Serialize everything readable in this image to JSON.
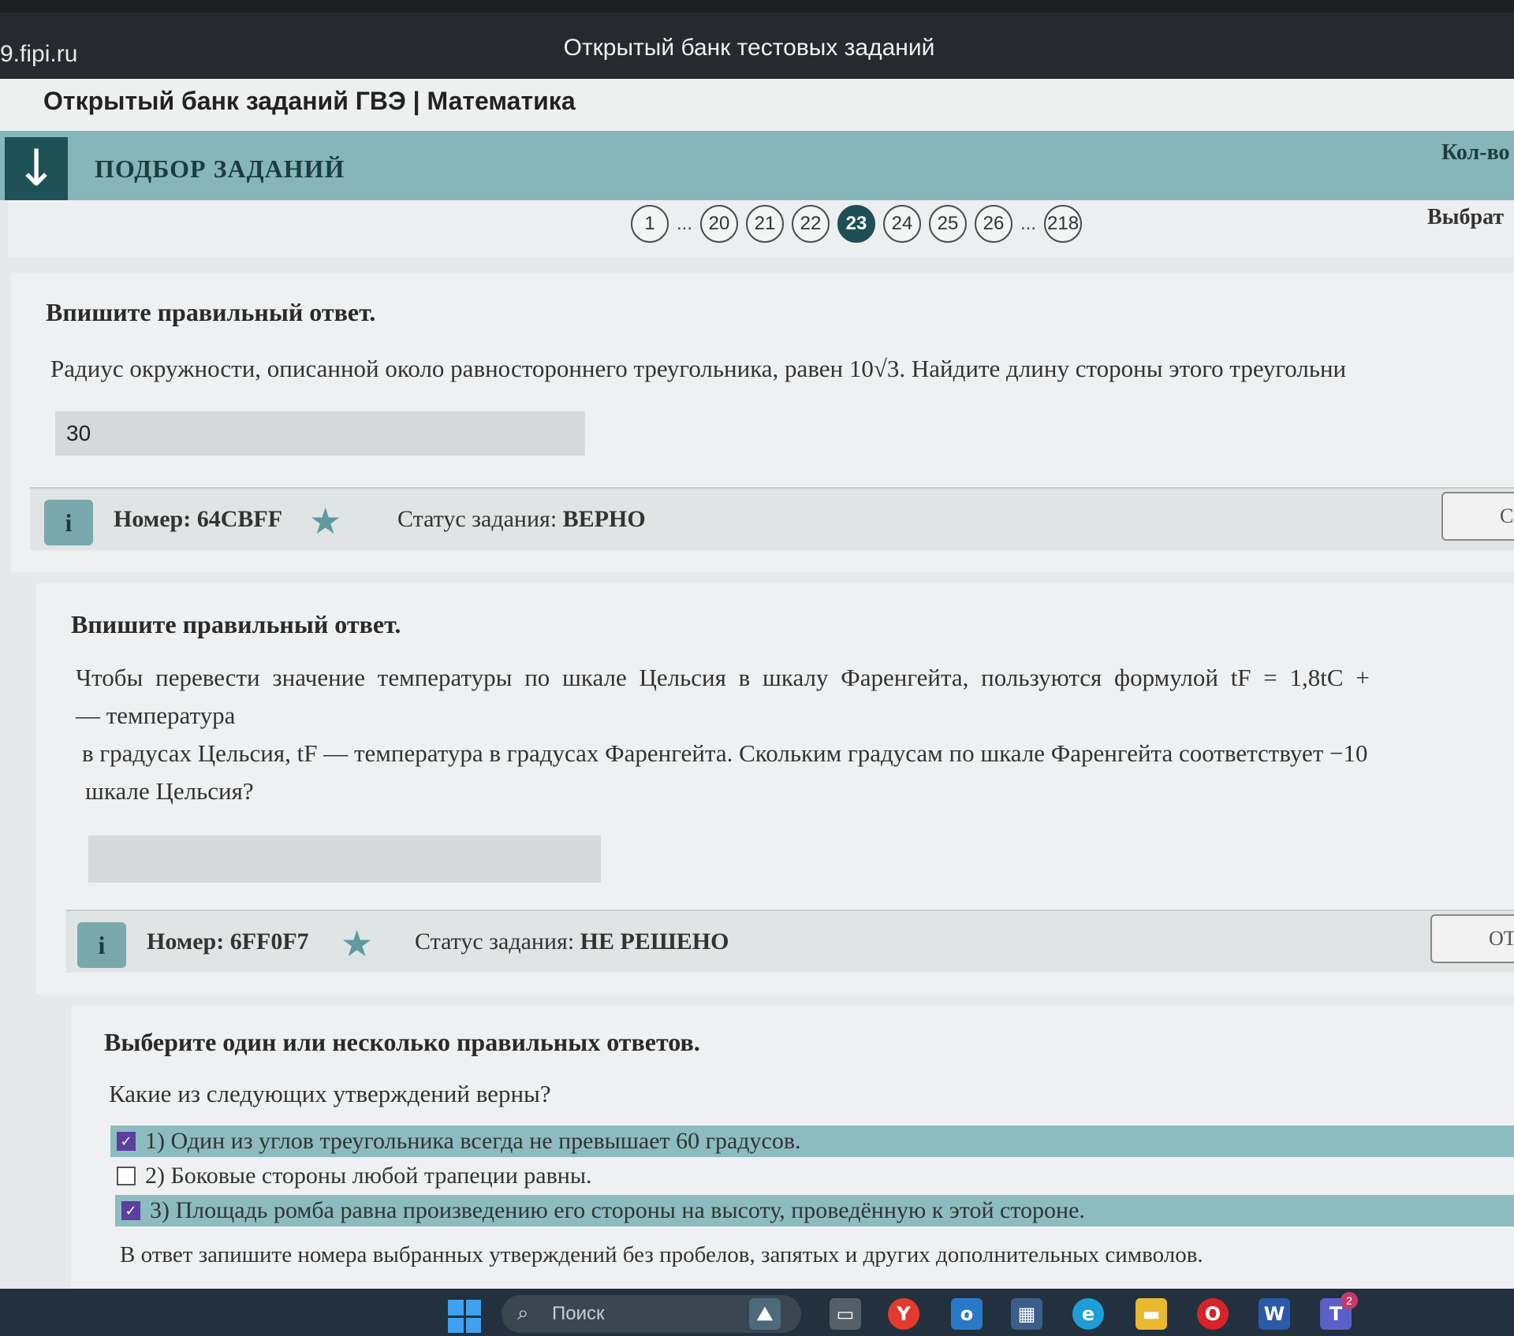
{
  "browser": {
    "domain": "9.fipi.ru",
    "window_title": "Открытый банк тестовых заданий"
  },
  "site": {
    "brand": "Открытый банк заданий ГВЭ | Математика"
  },
  "selection_bar": {
    "title": "ПОДБОР ЗАДАНИЙ",
    "count_label": "Кол-во",
    "select_label": "Выбрат"
  },
  "pagination": {
    "first": "1",
    "ellipsis": "...",
    "pages": [
      "20",
      "21",
      "22",
      "23",
      "24",
      "25",
      "26"
    ],
    "active": "23",
    "last": "218"
  },
  "tasks": [
    {
      "instruction": "Впишите правильный ответ.",
      "text": "Радиус окружности, описанной около равностороннего треугольника, равен 10√3. Найдите длину стороны этого треугольни",
      "answer": "30",
      "number_label": "Номер: 64CBFF",
      "status_prefix": "Статус задания:",
      "status_value": "ВЕРНО",
      "button_label": "С"
    },
    {
      "instruction": "Впишите правильный ответ.",
      "text_lines": [
        "Чтобы перевести значение температуры по шкале Цельсия в шкалу Фаренгейта, пользуются формулой tF = 1,8tC +",
        "— температура",
        "в градусах Цельсия, tF — температура в градусах Фаренгейта. Скольким градусам по шкале Фаренгейта соответствует −10",
        "шкале Цельсия?"
      ],
      "answer": "",
      "number_label": "Номер: 6FF0F7",
      "status_prefix": "Статус задания:",
      "status_value": "НЕ РЕШЕНО",
      "button_label": "ОТ"
    },
    {
      "instruction": "Выберите один или несколько правильных ответов.",
      "question": "Какие из следующих утверждений верны?",
      "options": [
        {
          "label": "1) Один из углов треугольника всегда не превышает 60 градусов.",
          "checked": true
        },
        {
          "label": "2) Боковые стороны любой трапеции равны.",
          "checked": false
        },
        {
          "label": "3) Площадь ромба равна произведению его стороны на высоту, проведённую к этой стороне.",
          "checked": true
        }
      ],
      "note": "В ответ запишите номера выбранных утверждений без пробелов, запятых и других дополнительных символов."
    }
  ],
  "taskbar": {
    "search_placeholder": "Поиск",
    "teams_badge": "2"
  }
}
